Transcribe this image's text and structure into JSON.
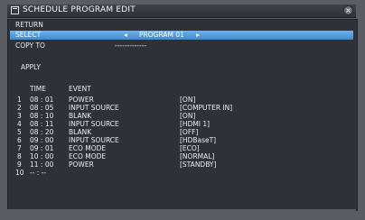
{
  "window": {
    "title": "SCHEDULE PROGRAM EDIT",
    "close_symbol": "×"
  },
  "menu": {
    "return_label": "RETURN",
    "select_label": "SELECT",
    "select_left_arrow": "◂",
    "select_value": "PROGRAM 01",
    "select_right_arrow": "▸",
    "copy_to_label": "COPY TO",
    "copy_to_value": "-------------",
    "apply_label": "APPLY"
  },
  "schedule": {
    "headers": {
      "time": "TIME",
      "event": "EVENT"
    },
    "rows": [
      {
        "num": "1",
        "time": "08 : 01",
        "event": "POWER",
        "param": "[ON]"
      },
      {
        "num": "2",
        "time": "08 : 05",
        "event": "INPUT SOURCE",
        "param": "[COMPUTER IN]"
      },
      {
        "num": "3",
        "time": "08 : 10",
        "event": "BLANK",
        "param": "[ON]"
      },
      {
        "num": "4",
        "time": "08 : 11",
        "event": "INPUT SOURCE",
        "param": "[HDMI 1]"
      },
      {
        "num": "5",
        "time": "08 : 20",
        "event": "BLANK",
        "param": "[OFF]"
      },
      {
        "num": "6",
        "time": "09 : 00",
        "event": "INPUT SOURCE",
        "param": "[HDBaseT]"
      },
      {
        "num": "7",
        "time": "09 : 01",
        "event": "ECO MODE",
        "param": "[ECO]"
      },
      {
        "num": "8",
        "time": "10 : 00",
        "event": "ECO MODE",
        "param": "[NORMAL]"
      },
      {
        "num": "9",
        "time": "11 : 00",
        "event": "POWER",
        "param": "[STANDBY]"
      },
      {
        "num": "10",
        "time": "-- : --",
        "event": "",
        "param": ""
      }
    ]
  },
  "colors": {
    "selection": "#4f9ae0",
    "panel": "#2e3136",
    "chrome": "#5a5d61"
  },
  "icons": {
    "title_icon": "window-icon",
    "close_icon": "close-icon"
  }
}
